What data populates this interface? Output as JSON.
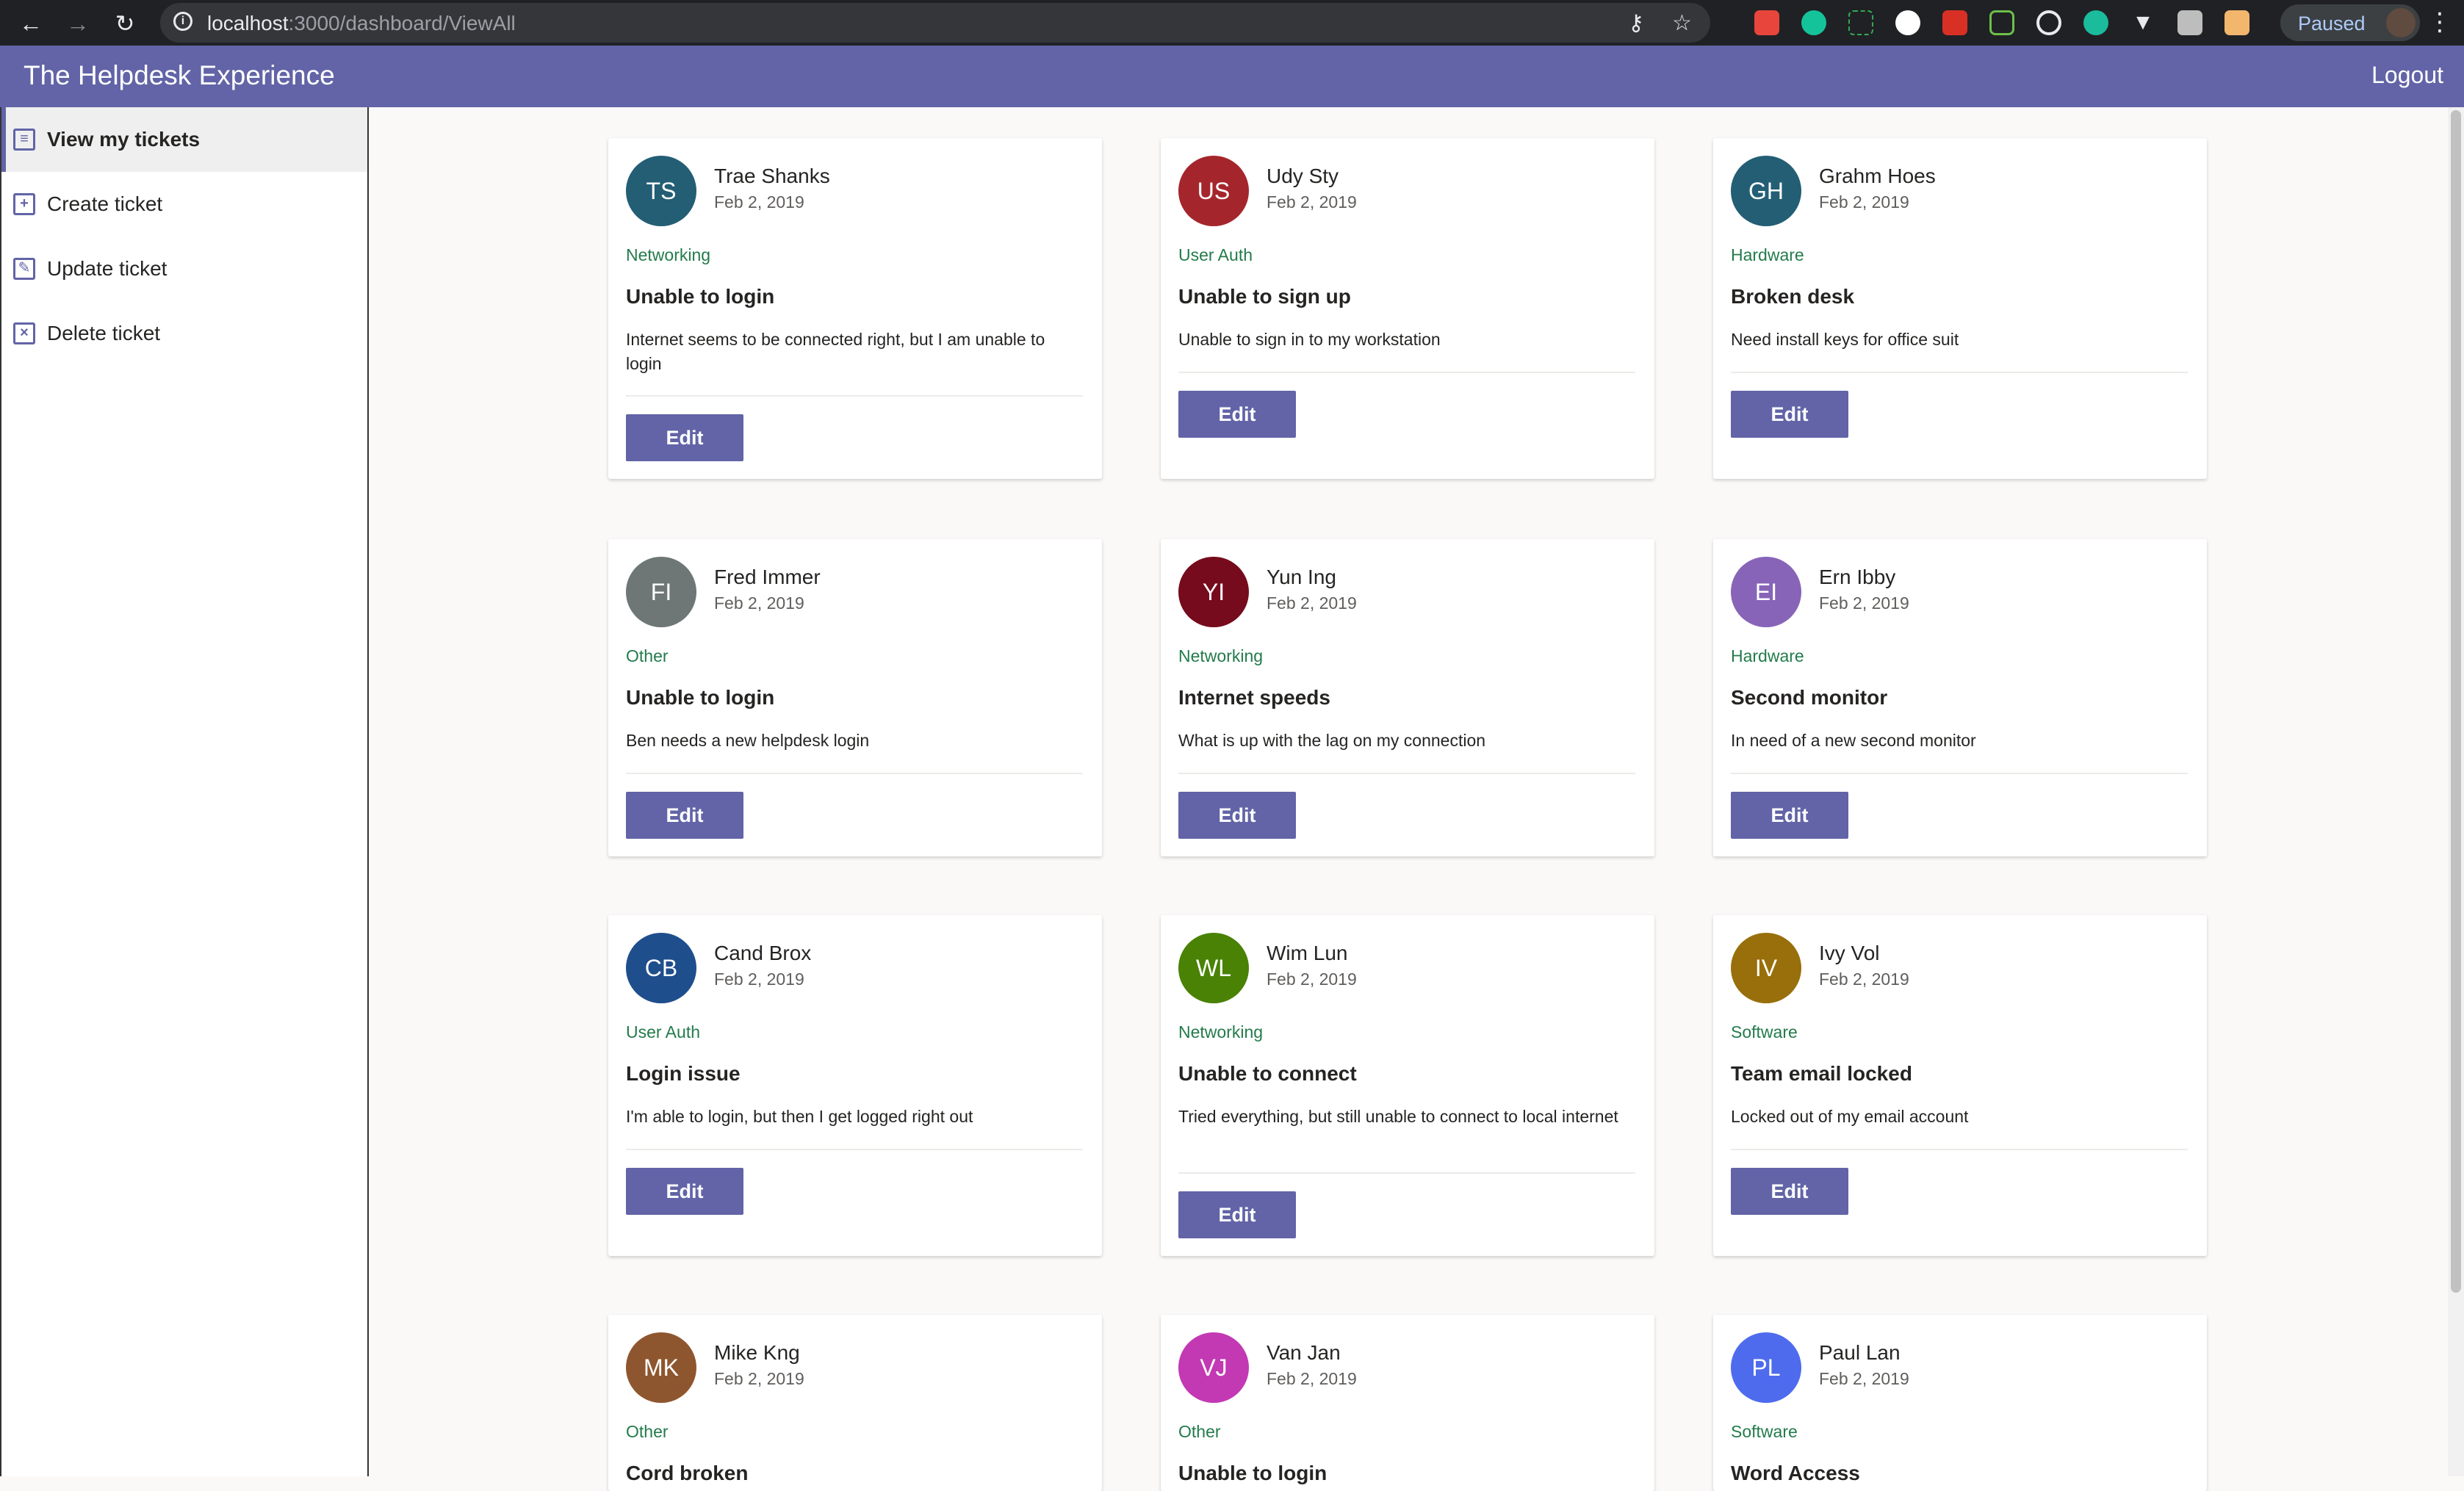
{
  "browser": {
    "url_host": "localhost",
    "url_path": ":3000/dashboard/ViewAll",
    "profile_status": "Paused"
  },
  "app": {
    "title": "The Helpdesk Experience",
    "logout_label": "Logout"
  },
  "sidebar": {
    "items": [
      {
        "label": "View my tickets",
        "icon": "document-icon"
      },
      {
        "label": "Create ticket",
        "icon": "plus-square-icon"
      },
      {
        "label": "Update ticket",
        "icon": "edit-icon"
      },
      {
        "label": "Delete ticket",
        "icon": "delete-document-icon"
      }
    ]
  },
  "edit_label": "Edit",
  "tickets": [
    {
      "initials": "TS",
      "name": "Trae Shanks",
      "date": "Feb 2, 2019",
      "category": "Networking",
      "title": "Unable to login",
      "description": "Internet seems to be connected right, but I am unable to login",
      "color": "#235e74"
    },
    {
      "initials": "US",
      "name": "Udy Sty",
      "date": "Feb 2, 2019",
      "category": "User Auth",
      "title": "Unable to sign up",
      "description": "Unable to sign in to my workstation",
      "color": "#a4262c"
    },
    {
      "initials": "GH",
      "name": "Grahm Hoes",
      "date": "Feb 2, 2019",
      "category": "Hardware",
      "title": "Broken desk",
      "description": "Need install keys for office suit",
      "color": "#235e74"
    },
    {
      "initials": "FI",
      "name": "Fred Immer",
      "date": "Feb 2, 2019",
      "category": "Other",
      "title": "Unable to login",
      "description": "Ben needs a new helpdesk login",
      "color": "#6e7676"
    },
    {
      "initials": "YI",
      "name": "Yun Ing",
      "date": "Feb 2, 2019",
      "category": "Networking",
      "title": "Internet speeds",
      "description": "What is up with the lag on my connection",
      "color": "#750b1c"
    },
    {
      "initials": "EI",
      "name": "Ern Ibby",
      "date": "Feb 2, 2019",
      "category": "Hardware",
      "title": "Second monitor",
      "description": "In need of a new second monitor",
      "color": "#8764b8"
    },
    {
      "initials": "CB",
      "name": "Cand Brox",
      "date": "Feb 2, 2019",
      "category": "User Auth",
      "title": "Login issue",
      "description": "I'm able to login, but then I get logged right out",
      "color": "#1e4e8c"
    },
    {
      "initials": "WL",
      "name": "Wim Lun",
      "date": "Feb 2, 2019",
      "category": "Networking",
      "title": "Unable to connect",
      "description": "Tried everything, but still unable to connect to local internet",
      "color": "#498205"
    },
    {
      "initials": "IV",
      "name": "Ivy Vol",
      "date": "Feb 2, 2019",
      "category": "Software",
      "title": "Team email locked",
      "description": "Locked out of my email account",
      "color": "#986f0b"
    },
    {
      "initials": "MK",
      "name": "Mike Kng",
      "date": "Feb 2, 2019",
      "category": "Other",
      "title": "Cord broken",
      "description": "",
      "color": "#8e562e"
    },
    {
      "initials": "VJ",
      "name": "Van Jan",
      "date": "Feb 2, 2019",
      "category": "Other",
      "title": "Unable to login",
      "description": "",
      "color": "#c239b3"
    },
    {
      "initials": "PL",
      "name": "Paul Lan",
      "date": "Feb 2, 2019",
      "category": "Software",
      "title": "Word Access",
      "description": "",
      "color": "#4f6bed"
    }
  ]
}
